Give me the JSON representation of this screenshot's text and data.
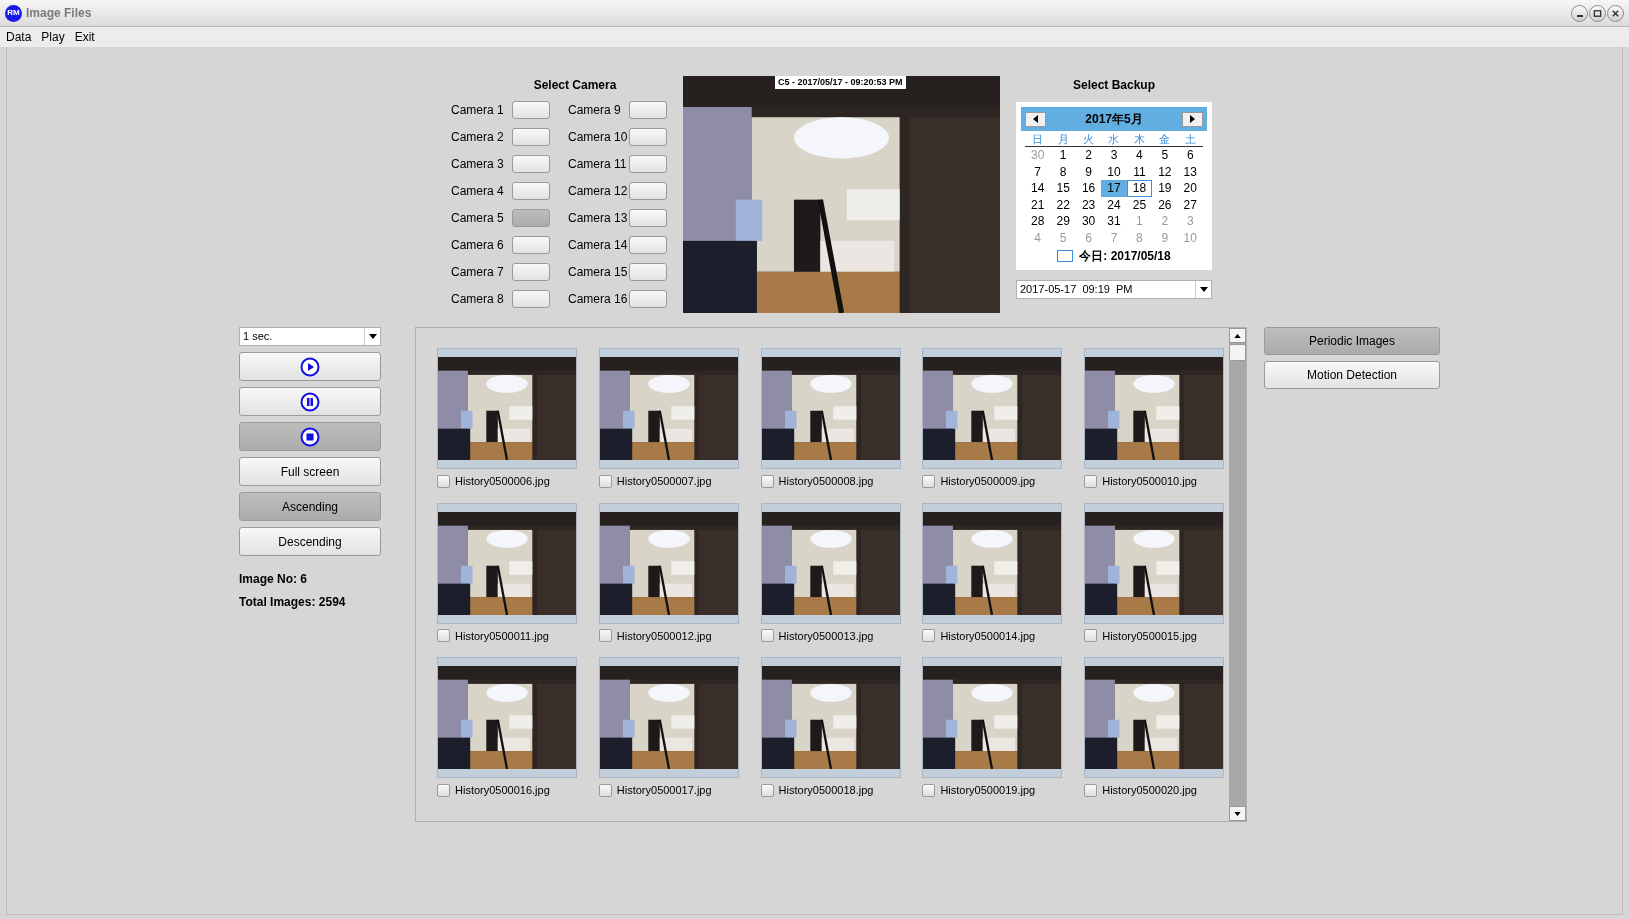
{
  "window": {
    "title": "Image Files",
    "logo": "RM"
  },
  "menu": [
    "Data",
    "Play",
    "Exit"
  ],
  "select_camera": {
    "title": "Select Camera",
    "cameras": [
      {
        "label": "Camera 1",
        "selected": false
      },
      {
        "label": "Camera 2",
        "selected": false
      },
      {
        "label": "Camera 3",
        "selected": false
      },
      {
        "label": "Camera 4",
        "selected": false
      },
      {
        "label": "Camera 5",
        "selected": true
      },
      {
        "label": "Camera 6",
        "selected": false
      },
      {
        "label": "Camera 7",
        "selected": false
      },
      {
        "label": "Camera 8",
        "selected": false
      },
      {
        "label": "Camera 9",
        "selected": false
      },
      {
        "label": "Camera 10",
        "selected": false
      },
      {
        "label": "Camera 11",
        "selected": false
      },
      {
        "label": "Camera 12",
        "selected": false
      },
      {
        "label": "Camera 13",
        "selected": false
      },
      {
        "label": "Camera 14",
        "selected": false
      },
      {
        "label": "Camera 15",
        "selected": false
      },
      {
        "label": "Camera 16",
        "selected": false
      }
    ]
  },
  "video": {
    "kind": "picture",
    "caption": "C5 - 2017/05/17 - 09:20:53 PM"
  },
  "select_backup": {
    "title": "Select Backup",
    "calendar": {
      "month": "2017年5月",
      "weekdays": [
        "日",
        "月",
        "火",
        "水",
        "木",
        "金",
        "土"
      ],
      "days": [
        {
          "day": "30",
          "muted": true,
          "selected": false,
          "today": false
        },
        {
          "day": "1",
          "muted": false,
          "selected": false,
          "today": false
        },
        {
          "day": "2",
          "muted": false,
          "selected": false,
          "today": false
        },
        {
          "day": "3",
          "muted": false,
          "selected": false,
          "today": false
        },
        {
          "day": "4",
          "muted": false,
          "selected": false,
          "today": false
        },
        {
          "day": "5",
          "muted": false,
          "selected": false,
          "today": false
        },
        {
          "day": "6",
          "muted": false,
          "selected": false,
          "today": false
        },
        {
          "day": "7",
          "muted": false,
          "selected": false,
          "today": false
        },
        {
          "day": "8",
          "muted": false,
          "selected": false,
          "today": false
        },
        {
          "day": "9",
          "muted": false,
          "selected": false,
          "today": false
        },
        {
          "day": "10",
          "muted": false,
          "selected": false,
          "today": false
        },
        {
          "day": "11",
          "muted": false,
          "selected": false,
          "today": false
        },
        {
          "day": "12",
          "muted": false,
          "selected": false,
          "today": false
        },
        {
          "day": "13",
          "muted": false,
          "selected": false,
          "today": false
        },
        {
          "day": "14",
          "muted": false,
          "selected": false,
          "today": false
        },
        {
          "day": "15",
          "muted": false,
          "selected": false,
          "today": false
        },
        {
          "day": "16",
          "muted": false,
          "selected": false,
          "today": false
        },
        {
          "day": "17",
          "muted": false,
          "selected": true,
          "today": false
        },
        {
          "day": "18",
          "muted": false,
          "selected": false,
          "today": true
        },
        {
          "day": "19",
          "muted": false,
          "selected": false,
          "today": false
        },
        {
          "day": "20",
          "muted": false,
          "selected": false,
          "today": false
        },
        {
          "day": "21",
          "muted": false,
          "selected": false,
          "today": false
        },
        {
          "day": "22",
          "muted": false,
          "selected": false,
          "today": false
        },
        {
          "day": "23",
          "muted": false,
          "selected": false,
          "today": false
        },
        {
          "day": "24",
          "muted": false,
          "selected": false,
          "today": false
        },
        {
          "day": "25",
          "muted": false,
          "selected": false,
          "today": false
        },
        {
          "day": "26",
          "muted": false,
          "selected": false,
          "today": false
        },
        {
          "day": "27",
          "muted": false,
          "selected": false,
          "today": false
        },
        {
          "day": "28",
          "muted": false,
          "selected": false,
          "today": false
        },
        {
          "day": "29",
          "muted": false,
          "selected": false,
          "today": false
        },
        {
          "day": "30",
          "muted": false,
          "selected": false,
          "today": false
        },
        {
          "day": "31",
          "muted": false,
          "selected": false,
          "today": false
        },
        {
          "day": "1",
          "muted": true,
          "selected": false,
          "today": false
        },
        {
          "day": "2",
          "muted": true,
          "selected": false,
          "today": false
        },
        {
          "day": "3",
          "muted": true,
          "selected": false,
          "today": false
        },
        {
          "day": "4",
          "muted": true,
          "selected": false,
          "today": false
        },
        {
          "day": "5",
          "muted": true,
          "selected": false,
          "today": false
        },
        {
          "day": "6",
          "muted": true,
          "selected": false,
          "today": false
        },
        {
          "day": "7",
          "muted": true,
          "selected": false,
          "today": false
        },
        {
          "day": "8",
          "muted": true,
          "selected": false,
          "today": false
        },
        {
          "day": "9",
          "muted": true,
          "selected": false,
          "today": false
        },
        {
          "day": "10",
          "muted": true,
          "selected": false,
          "today": false
        }
      ],
      "today_label": "今日: 2017/05/18"
    },
    "datetime": {
      "value": "2017-05-17  09:19  PM"
    }
  },
  "playback": {
    "interval": {
      "value": "1 sec."
    },
    "controls": [
      {
        "kind": "play",
        "selected": false
      },
      {
        "kind": "pause",
        "selected": false
      },
      {
        "kind": "stop",
        "selected": true
      }
    ],
    "view_buttons": [
      {
        "label": "Full screen",
        "selected": false
      },
      {
        "label": "Ascending",
        "selected": true
      },
      {
        "label": "Descending",
        "selected": false
      }
    ],
    "image_no": "Image No: 6",
    "total_images": "Total Images: 2594"
  },
  "thumbnails": [
    {
      "kind": "picture",
      "filename": "History0500006.jpg",
      "checked": false
    },
    {
      "kind": "picture",
      "filename": "History0500007.jpg",
      "checked": false
    },
    {
      "kind": "picture",
      "filename": "History0500008.jpg",
      "checked": false
    },
    {
      "kind": "picture",
      "filename": "History0500009.jpg",
      "checked": false
    },
    {
      "kind": "picture",
      "filename": "History0500010.jpg",
      "checked": false
    },
    {
      "kind": "picture",
      "filename": "History0500011.jpg",
      "checked": false
    },
    {
      "kind": "picture",
      "filename": "History0500012.jpg",
      "checked": false
    },
    {
      "kind": "picture",
      "filename": "History0500013.jpg",
      "checked": false
    },
    {
      "kind": "picture",
      "filename": "History0500014.jpg",
      "checked": false
    },
    {
      "kind": "picture",
      "filename": "History0500015.jpg",
      "checked": false
    },
    {
      "kind": "picture",
      "filename": "History0500016.jpg",
      "checked": false
    },
    {
      "kind": "picture",
      "filename": "History0500017.jpg",
      "checked": false
    },
    {
      "kind": "picture",
      "filename": "History0500018.jpg",
      "checked": false
    },
    {
      "kind": "picture",
      "filename": "History0500019.jpg",
      "checked": false
    },
    {
      "kind": "picture",
      "filename": "History0500020.jpg",
      "checked": false
    }
  ],
  "modes": [
    {
      "label": "Periodic Images",
      "selected": true
    },
    {
      "label": "Motion Detection",
      "selected": false
    }
  ]
}
